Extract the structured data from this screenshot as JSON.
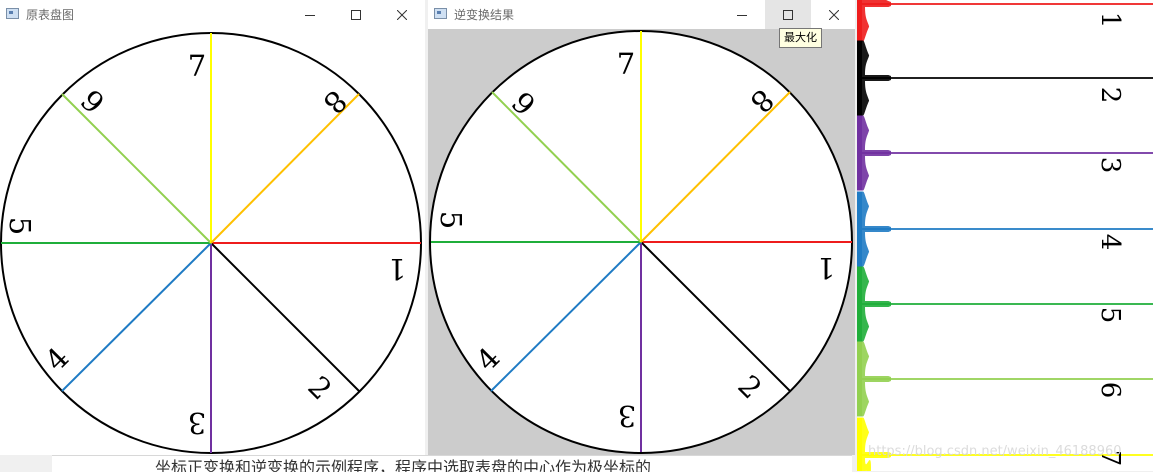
{
  "windows": [
    {
      "title": "原表盘图"
    },
    {
      "title": "逆变换结果"
    }
  ],
  "tooltip": "最大化",
  "dial_left": {
    "digits": [
      "7",
      "8",
      "6",
      "5",
      "1",
      "4",
      "2",
      "3"
    ]
  },
  "dial_right": {
    "digits": [
      "7",
      "8",
      "6",
      "5",
      "1",
      "4",
      "2",
      "3"
    ]
  },
  "strip": {
    "digits": [
      "1",
      "2",
      "3",
      "4",
      "5",
      "6",
      "7"
    ]
  },
  "colors": {
    "red": "#ee1c1c",
    "black": "#000000",
    "purple": "#7030a0",
    "blue": "#1f7bc4",
    "green": "#1fae3a",
    "lightgreen": "#92d050",
    "yellow": "#ffff00",
    "orange": "#ffc000"
  },
  "bottom_text": "坐标正变换和逆变换的示例程序，程序中选取表盘的中心作为极坐标的",
  "watermark": "https://blog.csdn.net/weixin_46188960"
}
